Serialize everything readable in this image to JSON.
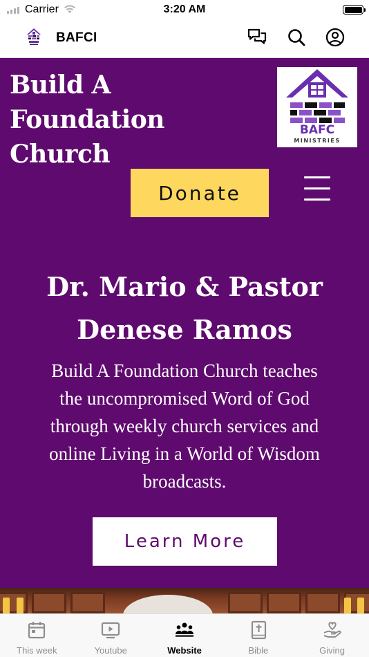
{
  "status_bar": {
    "carrier": "Carrier",
    "time": "3:20 AM"
  },
  "app_header": {
    "title": "BAFCI",
    "icons": [
      "chat-icon",
      "search-icon",
      "account-icon"
    ]
  },
  "hero": {
    "site_title_lines": [
      "Build A",
      "Foundation",
      "Church"
    ],
    "logo": {
      "text": "BAFC",
      "subtext": "MINISTRIES"
    },
    "donate_label": "Donate",
    "headline_lines": [
      "Dr. Mario & Pastor",
      "Denese Ramos"
    ],
    "description_lines": [
      "Build A Foundation Church teaches",
      "the uncompromised Word of God",
      "through weekly church services and",
      "online Living in a World of Wisdom",
      "broadcasts."
    ],
    "learn_more_label": "Learn More",
    "colors": {
      "background": "#5f0a6e",
      "donate": "#fed75f",
      "logo_purple": "#6a2fb0"
    }
  },
  "tab_bar": {
    "tabs": [
      {
        "label": "This week",
        "icon": "calendar-icon",
        "active": false
      },
      {
        "label": "Youtube",
        "icon": "tv-icon",
        "active": false
      },
      {
        "label": "Website",
        "icon": "people-icon",
        "active": true
      },
      {
        "label": "Bible",
        "icon": "bible-icon",
        "active": false
      },
      {
        "label": "Giving",
        "icon": "giving-icon",
        "active": false
      }
    ]
  }
}
